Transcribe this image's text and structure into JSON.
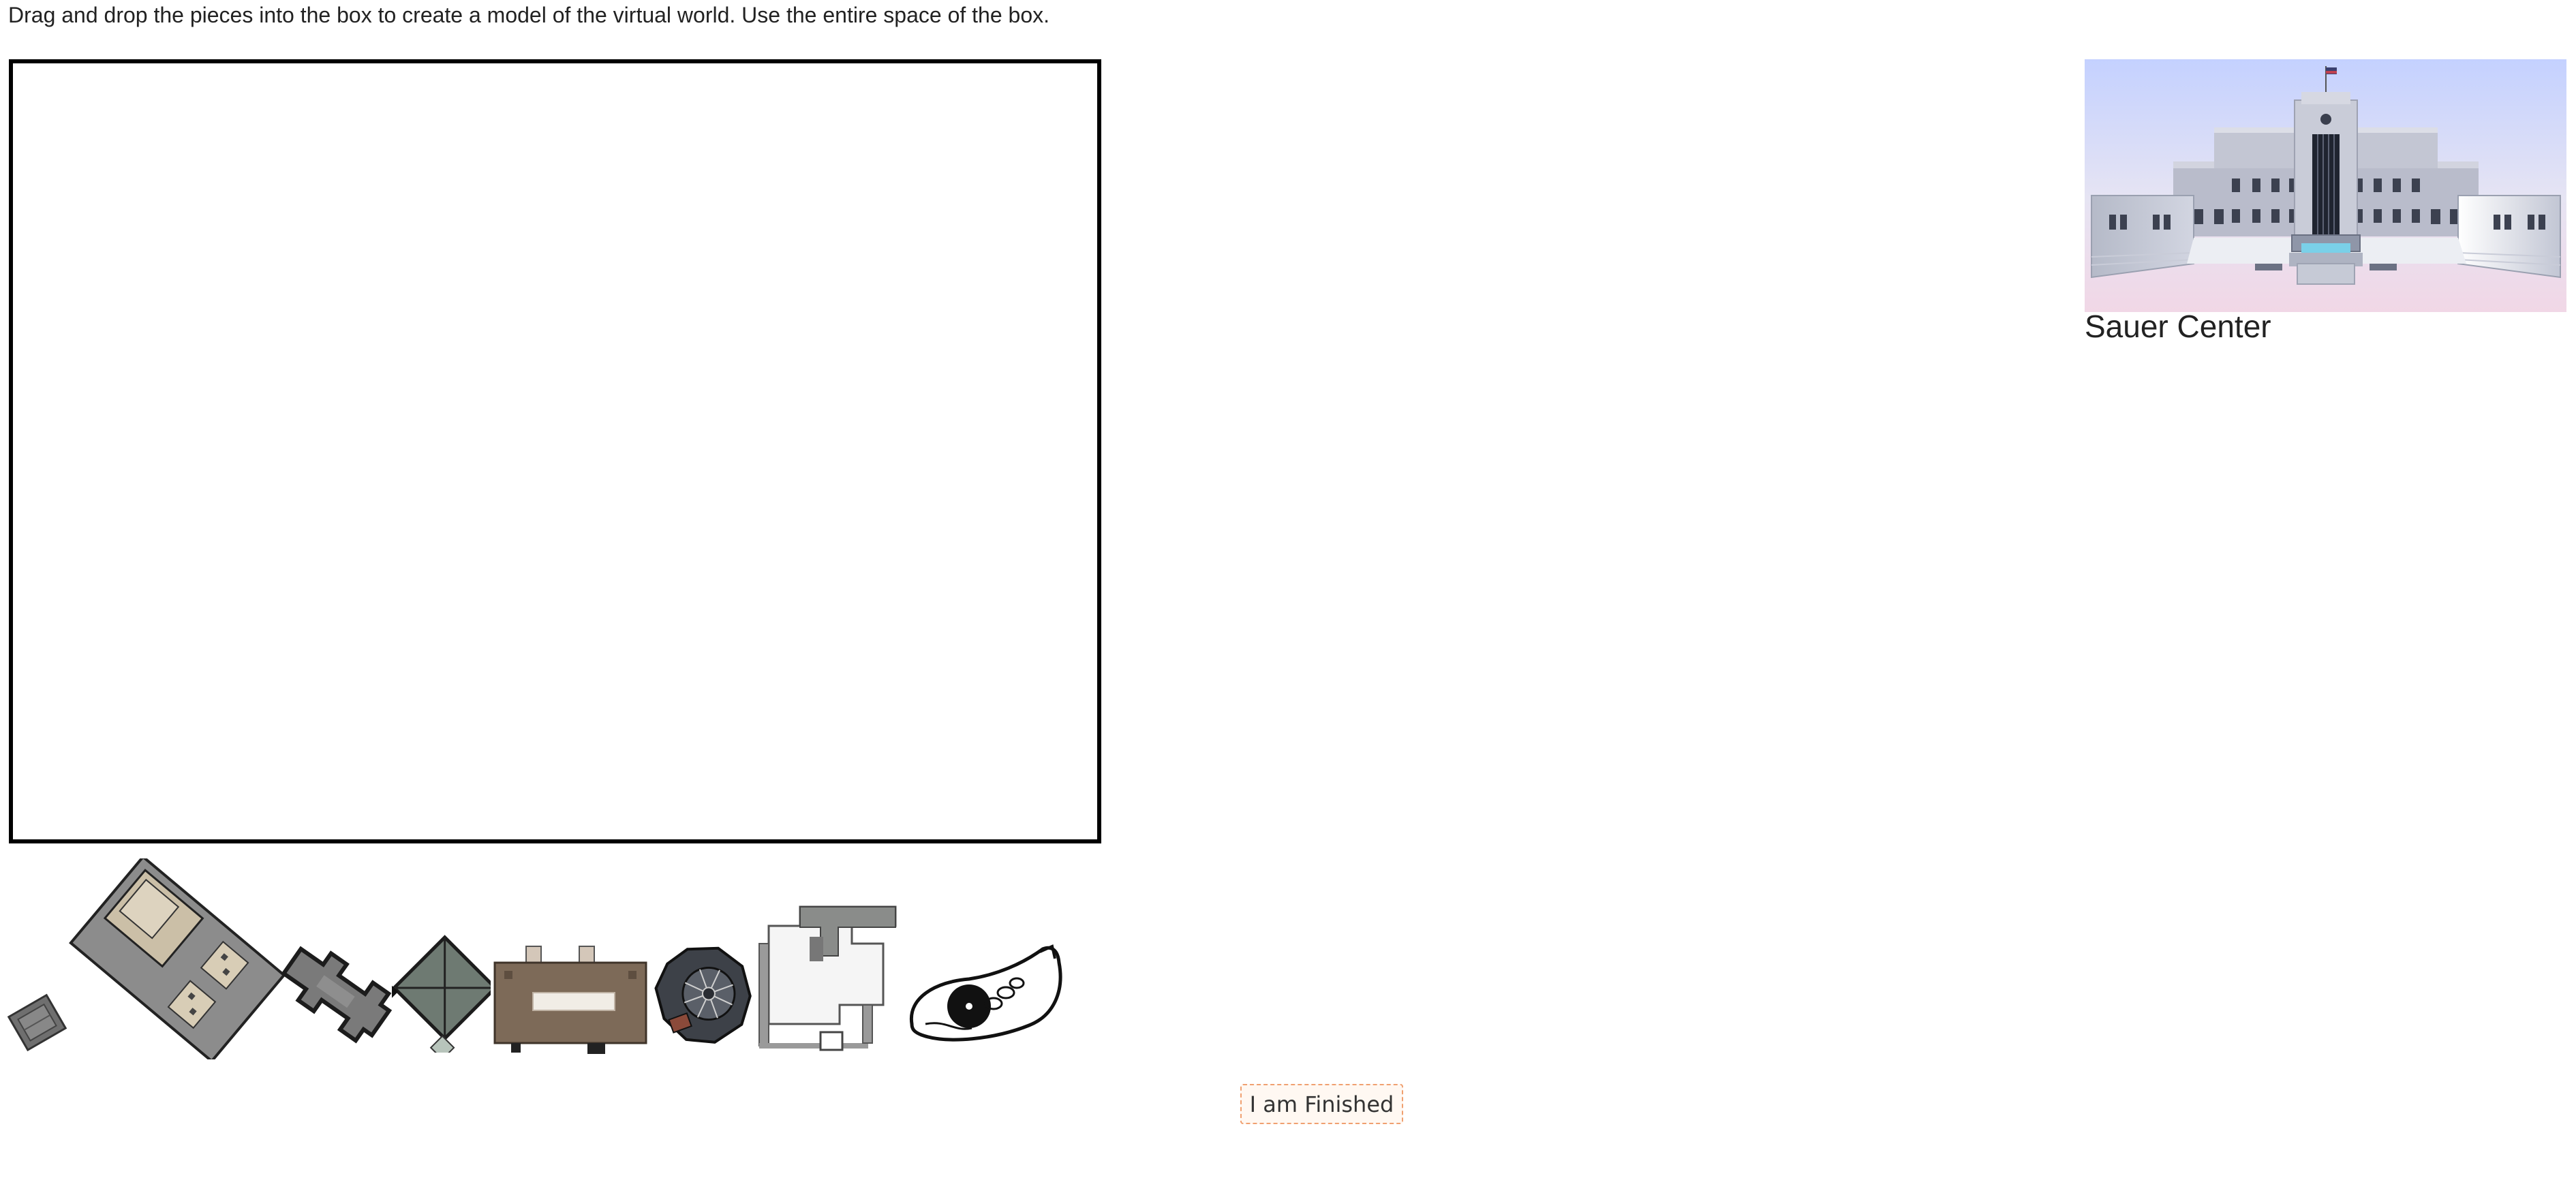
{
  "task": {
    "instructions": "Drag and drop the pieces into the box to create a model of the virtual world. Use the entire space of the box."
  },
  "pieces": [
    {
      "id": "piece-1",
      "icon": "small-gray-building-icon"
    },
    {
      "id": "piece-2",
      "icon": "large-gray-roof-building-icon"
    },
    {
      "id": "piece-3",
      "icon": "cross-shaped-building-icon"
    },
    {
      "id": "piece-4",
      "icon": "pyramid-roof-building-icon"
    },
    {
      "id": "piece-5",
      "icon": "brown-flat-roof-building-icon"
    },
    {
      "id": "piece-6",
      "icon": "round-dome-building-icon"
    },
    {
      "id": "piece-7",
      "icon": "white-t-shaped-building-icon"
    },
    {
      "id": "piece-8",
      "icon": "outlined-oval-plaza-icon"
    }
  ],
  "reference": {
    "label": "Sauer Center",
    "icon": "government-building-image"
  },
  "finish": {
    "label": "I am Finished"
  },
  "colors": {
    "drop_box_border": "#000000",
    "finish_border": "#f0a070"
  }
}
